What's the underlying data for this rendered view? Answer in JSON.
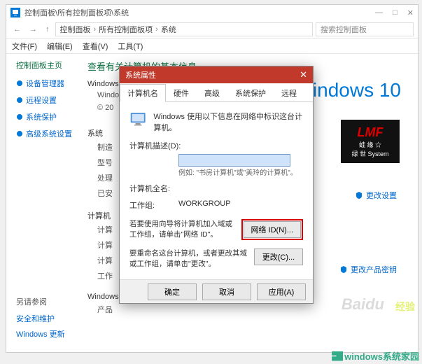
{
  "window_title": "控制面板\\所有控制面板项\\系统",
  "addressbar": {
    "crumbs": [
      "控制面板",
      "所有控制面板项",
      "系统"
    ],
    "search_placeholder": "搜索控制面板"
  },
  "menubar": [
    "文件(F)",
    "编辑(E)",
    "查看(V)",
    "工具(T)"
  ],
  "sidebar": {
    "home": "控制面板主页",
    "items": [
      {
        "label": "设备管理器"
      },
      {
        "label": "远程设置"
      },
      {
        "label": "系统保护"
      },
      {
        "label": "高级系统设置"
      }
    ]
  },
  "main": {
    "heading": "查看有关计算机的基本信息",
    "sections": [
      {
        "label": "Windows",
        "rows": [
          {
            "key": "Windows",
            "val": ""
          },
          {
            "key": "© 20",
            "val": ""
          }
        ]
      },
      {
        "label": "系统",
        "rows": [
          {
            "key": "制造",
            "val": ""
          },
          {
            "key": "型号",
            "val": ""
          },
          {
            "key": "处理",
            "val": ""
          },
          {
            "key": "已安",
            "val": ""
          }
        ]
      },
      {
        "label": "计算机",
        "rows": [
          {
            "key": "计算",
            "val": ""
          },
          {
            "key": "计算",
            "val": ""
          },
          {
            "key": "计算",
            "val": ""
          },
          {
            "key": "工作",
            "val": ""
          }
        ]
      },
      {
        "label": "Windows",
        "rows": [
          {
            "key": "产品",
            "val": ""
          }
        ]
      }
    ]
  },
  "brand_win10": "Windows 10",
  "lmf": {
    "big": "LMF",
    "line1": "蛙 缘 ☆",
    "line2": "绿 世 System"
  },
  "link_change": "更改设置",
  "link_productkey": "更改产品密钥",
  "see_also": {
    "title": "另请参阅",
    "links": [
      "安全和维护",
      "Windows 更新"
    ]
  },
  "dialog": {
    "title": "系统属性",
    "tabs": [
      "计算机名",
      "硬件",
      "高级",
      "系统保护",
      "远程"
    ],
    "info_line": "Windows 使用以下信息在网络中标识这台计算机。",
    "desc_label": "计算机描述(D):",
    "desc_hint": "例如: \"书房计算机\"或\"美玲的计算机\"。",
    "fullname_label": "计算机全名:",
    "fullname_value": "",
    "workgroup_label": "工作组:",
    "workgroup_value": "WORKGROUP",
    "wizard_text": "若要使用向导将计算机加入域或工作组，请单击\"网络 ID\"。",
    "wizard_btn": "网络 ID(N)...",
    "rename_text": "要重命名这台计算机，或者更改其域或工作组，请单击\"更改\"。",
    "rename_btn": "更改(C)...",
    "footer": {
      "ok": "确定",
      "cancel": "取消",
      "apply": "应用(A)"
    }
  },
  "watermark": {
    "baidu": "Baidu",
    "jingyan": "经验",
    "winjy": "windows系统家园"
  }
}
